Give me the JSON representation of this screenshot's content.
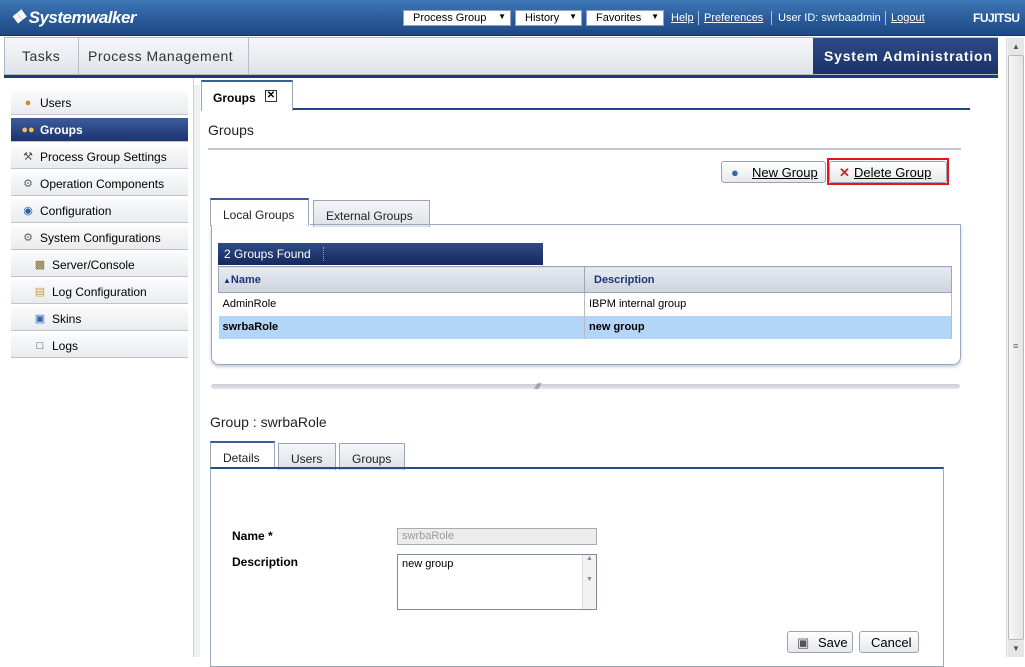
{
  "topbar": {
    "brand": "Systemwalker",
    "process_group_label": "Process Group",
    "history_label": "History",
    "favorites_label": "Favorites",
    "help_label": "Help",
    "preferences_label": "Preferences",
    "user_id": "User ID: swrbaadmin",
    "logout_label": "Logout",
    "vendor": "FUJITSU"
  },
  "nav": {
    "tasks": "Tasks",
    "process_management": "Process Management",
    "system_administration": "System Administration"
  },
  "sidebar": {
    "items": [
      {
        "label": "Users",
        "icon": "user-icon"
      },
      {
        "label": "Groups",
        "icon": "group-icon"
      },
      {
        "label": "Process Group Settings",
        "icon": "tools-icon"
      },
      {
        "label": "Operation Components",
        "icon": "gear-icon"
      },
      {
        "label": "Configuration",
        "icon": "config-icon"
      },
      {
        "label": "System Configurations",
        "icon": "gears-icon"
      },
      {
        "label": "Server/Console",
        "icon": "server-icon"
      },
      {
        "label": "Log Configuration",
        "icon": "log-config-icon"
      },
      {
        "label": "Skins",
        "icon": "skins-icon"
      },
      {
        "label": "Logs",
        "icon": "logs-icon"
      }
    ]
  },
  "main": {
    "tab_label": "Groups",
    "page_title": "Groups",
    "new_group_label": "New Group",
    "delete_group_label": "Delete Group",
    "tabs": {
      "local": "Local Groups",
      "external": "External Groups"
    },
    "found_label": "2 Groups Found",
    "table": {
      "col_name": "Name",
      "col_description": "Description",
      "rows": [
        {
          "name": "AdminRole",
          "description": "IBPM internal group"
        },
        {
          "name": "swrbaRole",
          "description": "new group"
        }
      ]
    },
    "group_title": "Group : swrbaRole",
    "detail_tabs": {
      "details": "Details",
      "users": "Users",
      "groups": "Groups"
    },
    "form": {
      "name_label": "Name *",
      "name_value": "swrbaRole",
      "description_label": "Description",
      "description_value": "new group",
      "save_label": "Save",
      "cancel_label": "Cancel"
    }
  }
}
